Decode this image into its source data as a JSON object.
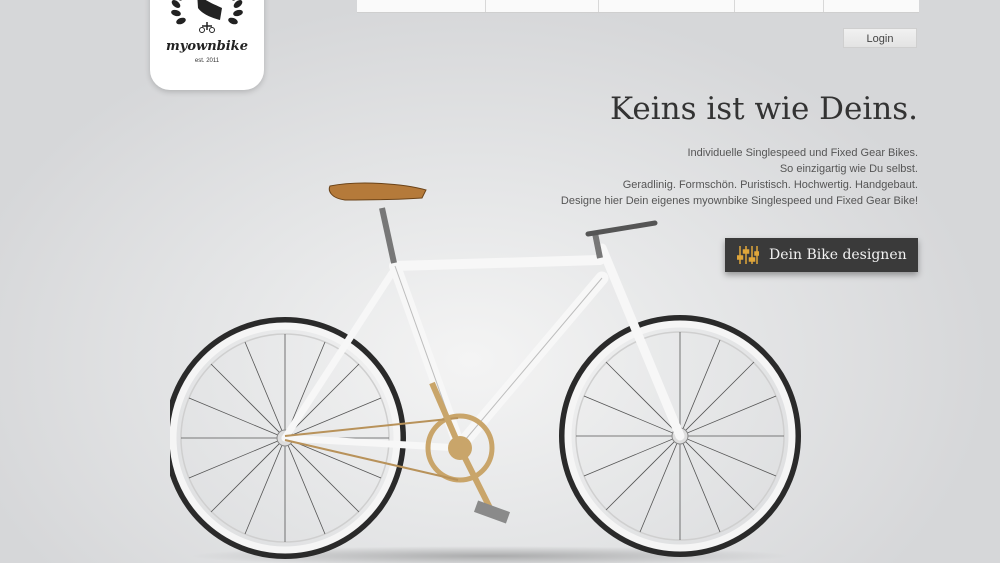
{
  "logo": {
    "brand": "myownbike",
    "est": "est. 2011",
    "icon_name": "bike-logo-wreath-icon"
  },
  "nav": {
    "login_label": "Login"
  },
  "hero": {
    "headline": "Keins ist wie Deins.",
    "tagline": [
      "Individuelle Singlespeed und Fixed Gear Bikes.",
      "So einzigartig wie Du selbst.",
      "Geradlinig. Formschön. Puristisch. Hochwertig. Handgebaut.",
      "Designe hier Dein eigenes myownbike Singlespeed und Fixed Gear Bike!"
    ],
    "cta_label": "Dein Bike designen",
    "cta_icon": "sliders-icon",
    "accent_color": "#e0a63a",
    "button_color": "#3a3a3a"
  },
  "images": {
    "bike": "white-singlespeed-bike"
  }
}
